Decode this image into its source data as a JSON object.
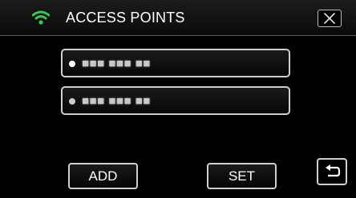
{
  "header": {
    "title": "ACCESS POINTS",
    "wifi_icon": "wifi-icon",
    "close_icon": "close-icon",
    "accent_color": "#34c759"
  },
  "access_points": [
    {
      "name": "■■■ ■■■ ■■",
      "selected": true
    },
    {
      "name": "■■■ ■■■ ■■",
      "selected": false
    }
  ],
  "footer": {
    "add_label": "ADD",
    "set_label": "SET",
    "back_icon": "return-arrow-icon"
  }
}
